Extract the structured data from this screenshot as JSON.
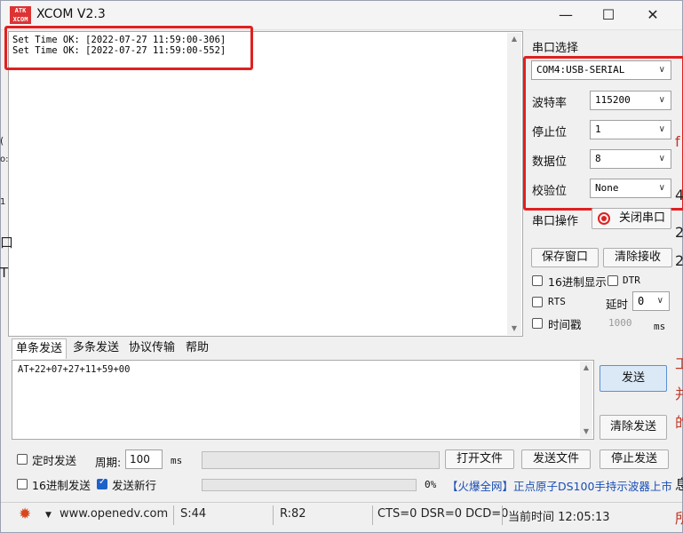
{
  "window": {
    "title": "XCOM V2.3",
    "logo_text": "ATK\nXCOM"
  },
  "window_controls": {
    "minimize": "—",
    "maximize": "☐",
    "close": "✕"
  },
  "receive": {
    "lines": [
      "Set Time OK: [2022-07-27 11:59:00-306]",
      "Set Time OK: [2022-07-27 11:59:00-552]"
    ]
  },
  "serial": {
    "section_label": "串口选择",
    "port": "COM4:USB-SERIAL",
    "baud_label": "波特率",
    "baud": "115200",
    "stop_label": "停止位",
    "stop": "1",
    "data_label": "数据位",
    "data": "8",
    "parity_label": "校验位",
    "parity": "None",
    "op_label": "串口操作",
    "close_port": "关闭串口"
  },
  "buttons": {
    "save_window": "保存窗口",
    "clear_receive": "清除接收",
    "send": "发送",
    "clear_send": "清除发送",
    "open_file": "打开文件",
    "send_file": "发送文件",
    "stop_send": "停止发送"
  },
  "options": {
    "hex_display": "16进制显示",
    "dtr": "DTR",
    "rts": "RTS",
    "delay_label": "延时",
    "delay_value": "0",
    "timestamp": "时间戳",
    "timestamp_value": "1000",
    "ms": "ms"
  },
  "tabs": [
    "单条发送",
    "多条发送",
    "协议传输",
    "帮助"
  ],
  "send": {
    "text": "AT+22+07+27+11+59+00",
    "timed_send": "定时发送",
    "period_label": "周期:",
    "period_value": "100",
    "period_unit": "ms",
    "hex_send": "16进制发送",
    "send_newline": "发送新行",
    "progress_percent": "0%",
    "progress_value": 0,
    "ad_text": "【火爆全网】正点原子DS100手持示波器上市"
  },
  "status": {
    "website": "www.openedv.com",
    "sent": "S:44",
    "received": "R:82",
    "signals": "CTS=0 DSR=0 DCD=0",
    "time": "当前时间 12:05:13"
  },
  "background": {
    "left_fragments": [
      "(",
      "o:",
      "1",
      "口",
      "T"
    ],
    "right_fragments": [
      "f",
      "4",
      "2",
      "2",
      "工",
      "并",
      "的",
      "息",
      "所"
    ]
  },
  "colors": {
    "highlight_box": "#e02020",
    "accent": "#1e62c8"
  }
}
